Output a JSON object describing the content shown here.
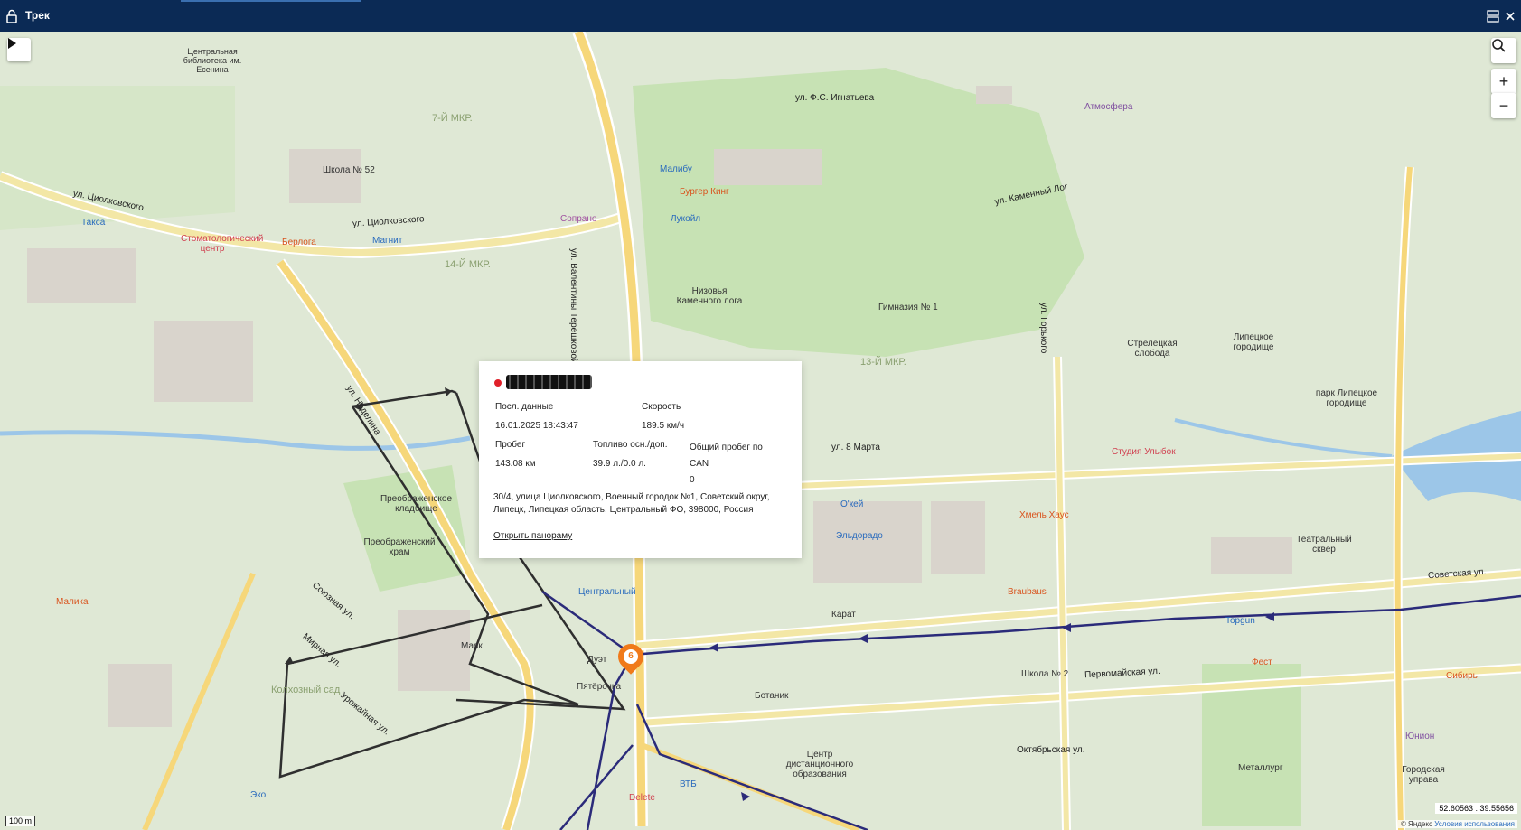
{
  "window": {
    "title": "Трек",
    "lock_icon": "lock-icon",
    "layout_icon": "layout-icon",
    "close_icon": "close-icon"
  },
  "map": {
    "play_icon": "play-icon",
    "search_icon": "search-icon",
    "zoom_in": "+",
    "zoom_out": "−",
    "scale_label": "100 m",
    "coordinates": "52.60563 : 39.55656",
    "copyright": "© Яндекс",
    "terms": "Условия использования",
    "streets": [
      "ул. Циолковского",
      "ул. Циолковского",
      "ул. Валентины Терешковой",
      "ул. Неделина",
      "ул. 8 Марта",
      "Советская ул.",
      "Первомайская ул.",
      "ул. Каменный Лог",
      "ул. Ф.С. Игнатьева",
      "ул. Горького",
      "Октябрьская ул.",
      "Союзная ул.",
      "Мирная ул.",
      "Урожайная ул."
    ],
    "districts": [
      "7-Й МКР.",
      "14-Й МКР.",
      "13-Й МКР.",
      "Колхозный сад"
    ],
    "pois": [
      "Малибу",
      "Бургер Кинг",
      "Лукойл",
      "Сопрано",
      "Магнит",
      "Берлога",
      "Стоматологический центр",
      "Такса",
      "Школа № 52",
      "Низовья Каменного лога",
      "Гимназия № 1",
      "Атмосфера",
      "Центральная библиотека им. Есенина",
      "Маяк",
      "Центральный",
      "Пятёрочка",
      "Дуэт",
      "Ботаник",
      "Карат",
      "Эльдорадо",
      "О'кей",
      "Хмель Хаус",
      "Braubaus",
      "Студия Улыбок",
      "Школа № 2",
      "Металлург",
      "Topgun",
      "ВТБ",
      "Delete",
      "Эко",
      "Малика",
      "Преображенский храм",
      "Преображенское кладбище",
      "Стрелецкая слобода",
      "Липецкое городище",
      "парк Липецкое городище",
      "Театральный сквер",
      "Сибирь",
      "Фест",
      "Юнион",
      "Городская управа",
      "Центр дистанционного образования"
    ],
    "track_marker_label": "6"
  },
  "popup": {
    "object_name": "",
    "last_data_label": "Посл. данные",
    "last_data_value": "16.01.2025 18:43:47",
    "speed_label": "Скорость",
    "speed_value": "189.5 км/ч",
    "mileage_label": "Пробег",
    "mileage_value": "143.08 км",
    "fuel_label": "Топливо осн./доп.",
    "fuel_value": "39.9 л./0.0 л.",
    "can_label": "Общий пробег по CAN",
    "can_value": "0",
    "address": "30/4, улица Циолковского, Военный городок №1, Советский округ, Липецк, Липецкая область, Центральный ФО, 398000, Россия",
    "panorama_link": "Открыть панораму"
  },
  "colors": {
    "titlebar": "#0b2a55",
    "track_dark": "#2f2f2f",
    "track_blue": "#2b2b7a",
    "marker": "#f07a1a",
    "status_dot": "#e0202a"
  }
}
